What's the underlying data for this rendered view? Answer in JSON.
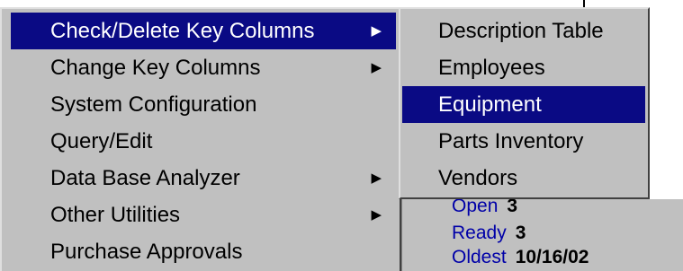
{
  "main_menu": {
    "items": [
      {
        "label": "Check/Delete Key Columns",
        "has_submenu": true,
        "highlighted": true
      },
      {
        "label": "Change Key Columns",
        "has_submenu": true,
        "highlighted": false
      },
      {
        "label": "System Configuration",
        "has_submenu": false,
        "highlighted": false
      },
      {
        "label": "Query/Edit",
        "has_submenu": false,
        "highlighted": false
      },
      {
        "label": "Data Base Analyzer",
        "has_submenu": true,
        "highlighted": false
      },
      {
        "label": "Other Utilities",
        "has_submenu": true,
        "highlighted": false
      },
      {
        "label": "Purchase Approvals",
        "has_submenu": false,
        "highlighted": false
      }
    ]
  },
  "sub_menu": {
    "items": [
      {
        "label": "Description Table",
        "highlighted": false
      },
      {
        "label": "Employees",
        "highlighted": false
      },
      {
        "label": "Equipment",
        "highlighted": true
      },
      {
        "label": "Parts Inventory",
        "highlighted": false
      },
      {
        "label": "Vendors",
        "highlighted": false
      }
    ]
  },
  "status_panel": {
    "rows": [
      {
        "label": "Open",
        "value": "3"
      },
      {
        "label": "Ready",
        "value": "3"
      },
      {
        "label": "Oldest",
        "value": "10/16/02"
      }
    ]
  },
  "icons": {
    "submenu_arrow": "triangle-right-icon"
  },
  "colors": {
    "menu_bg": "#c0c0c0",
    "highlight_bg": "#0a0a84",
    "highlight_text": "#ffffff",
    "status_label": "#0000a8"
  }
}
